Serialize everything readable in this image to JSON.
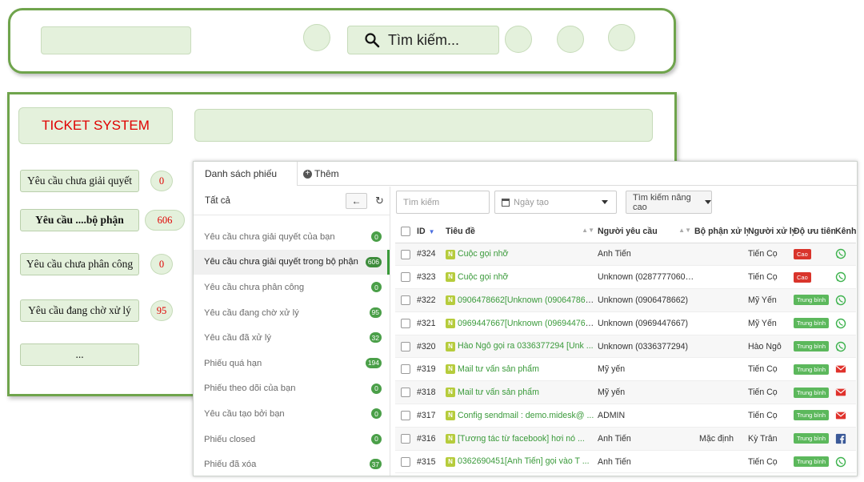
{
  "header": {
    "search_label": "Tìm kiếm..."
  },
  "mock": {
    "logo": "TICKET SYSTEM",
    "items": [
      {
        "label": "Yêu cầu chưa giải quyết",
        "count": "0"
      },
      {
        "label": "Yêu cầu ....bộ phận",
        "count": "606"
      },
      {
        "label": "Yêu cầu chưa phân công",
        "count": "0"
      },
      {
        "label": "Yêu cầu đang chờ xử lý",
        "count": "95"
      },
      {
        "label": "..."
      }
    ]
  },
  "app": {
    "tabs": {
      "list": "Danh sách phiếu",
      "add": "Thêm"
    },
    "left_header": "Tất cả",
    "nav": [
      {
        "label": "Yêu cầu chưa giải quyết của bạn",
        "count": "0"
      },
      {
        "label": "Yêu cầu chưa giải quyết trong bộ phận",
        "count": "606"
      },
      {
        "label": "Yêu cầu chưa phân công",
        "count": "0"
      },
      {
        "label": "Yêu cầu đang chờ xử lý",
        "count": "95"
      },
      {
        "label": "Yêu cầu đã xử lý",
        "count": "32"
      },
      {
        "label": "Phiếu quá hạn",
        "count": "194"
      },
      {
        "label": "Phiếu theo dõi của bạn",
        "count": "0"
      },
      {
        "label": "Yêu cầu tạo bởi bạn",
        "count": "0"
      },
      {
        "label": "Phiếu closed",
        "count": "0"
      },
      {
        "label": "Phiếu đã xóa",
        "count": "37"
      }
    ],
    "filters": {
      "search_placeholder": "Tìm kiếm",
      "date_placeholder": "Ngày tạo",
      "advanced": "Tìm kiếm nâng cao"
    },
    "columns": [
      "ID",
      "Tiêu đề",
      "Người yêu cầu",
      "Bộ phận xử lý",
      "Người xử lý",
      "Độ ưu tiên",
      "Kênh"
    ],
    "rows": [
      {
        "id": "#324",
        "title": "Cuộc gọi nhỡ",
        "requester": "Anh Tiến",
        "dept": "",
        "handler": "Tiến Cọ",
        "priority": "Cao",
        "channel": "whatsapp"
      },
      {
        "id": "#323",
        "title": "Cuộc gọi nhỡ",
        "requester": "Unknown (02877770609 ...",
        "dept": "",
        "handler": "Tiến Cọ",
        "priority": "Cao",
        "channel": "whatsapp"
      },
      {
        "id": "#322",
        "title": "0906478662[Unknown (0906478662 ...",
        "requester": "Unknown (0906478662)",
        "dept": "",
        "handler": "Mỹ Yến",
        "priority": "Trung bình",
        "channel": "whatsapp"
      },
      {
        "id": "#321",
        "title": "0969447667[Unknown (0969447667 ...",
        "requester": "Unknown (0969447667)",
        "dept": "",
        "handler": "Mỹ Yến",
        "priority": "Trung bình",
        "channel": "whatsapp"
      },
      {
        "id": "#320",
        "title": "Hào Ngô gọi ra 0336377294 [Unk ...",
        "requester": "Unknown (0336377294)",
        "dept": "",
        "handler": "Hào Ngô",
        "priority": "Trung bình",
        "channel": "whatsapp"
      },
      {
        "id": "#319",
        "title": "Mail tư vấn sản phẩm",
        "requester": "Mỹ yến",
        "dept": "",
        "handler": "Tiến Cọ",
        "priority": "Trung bình",
        "channel": "mail"
      },
      {
        "id": "#318",
        "title": "Mail tư vấn sản phẩm",
        "requester": "Mỹ yến",
        "dept": "",
        "handler": "Tiến Cọ",
        "priority": "Trung bình",
        "channel": "mail"
      },
      {
        "id": "#317",
        "title": "Config sendmail : demo.midesk@ ...",
        "requester": "ADMIN",
        "dept": "",
        "handler": "Tiến Cọ",
        "priority": "Trung bình",
        "channel": "mail"
      },
      {
        "id": "#316",
        "title": "[Tương tác từ facebook] hơi nó ...",
        "requester": "Anh Tiến",
        "dept": "Mặc định",
        "handler": "Kỳ Trân",
        "priority": "Trung bình",
        "channel": "facebook"
      },
      {
        "id": "#315",
        "title": "0362690451[Anh Tiến] gọi vào T ...",
        "requester": "Anh Tiến",
        "dept": "",
        "handler": "Tiến Cọ",
        "priority": "Trung bình",
        "channel": "whatsapp"
      }
    ],
    "new_badge": "N"
  },
  "colors": {
    "accent_green": "#3a9a3a",
    "frame_green": "#6fa44c",
    "mock_fill": "#e4f1dc",
    "priority_high": "#d9342b",
    "priority_medium": "#5cb85c",
    "logo_red": "#e00000"
  }
}
